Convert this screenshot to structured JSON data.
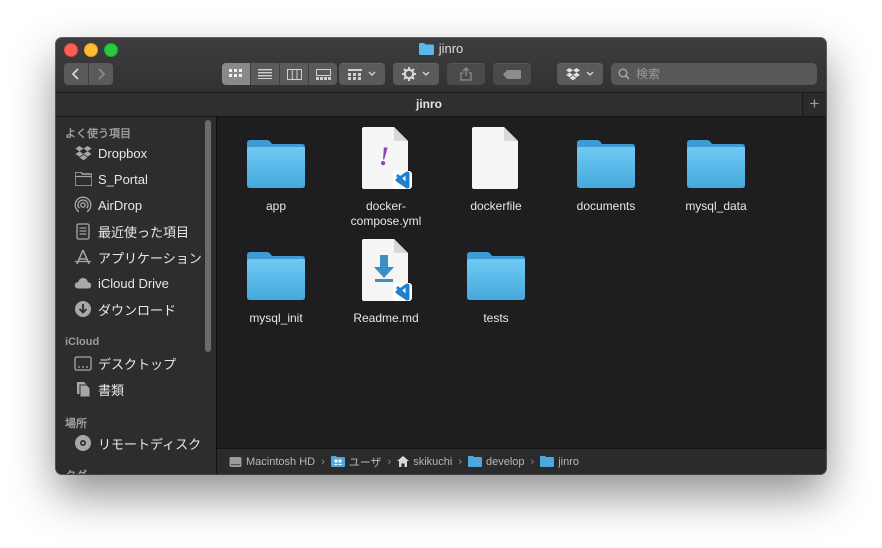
{
  "window": {
    "title": "jinro",
    "traffic_lights": [
      "close",
      "minimize",
      "zoom"
    ]
  },
  "toolbar": {
    "back_label": "‹",
    "forward_label": "›",
    "view_modes": [
      "icon-view",
      "list-view",
      "column-view",
      "gallery-view"
    ],
    "active_view": "icon-view",
    "search_placeholder": "検索"
  },
  "tabbar": {
    "tab_label": "jinro",
    "add_label": "+"
  },
  "sidebar": {
    "sections": [
      {
        "header": "よく使う項目",
        "items": [
          {
            "label": "Dropbox",
            "icon": "dropbox-icon"
          },
          {
            "label": "S_Portal",
            "icon": "folder-icon"
          },
          {
            "label": "AirDrop",
            "icon": "airdrop-icon"
          },
          {
            "label": "最近使った項目",
            "icon": "recents-icon"
          },
          {
            "label": "アプリケーション",
            "icon": "applications-icon"
          },
          {
            "label": "iCloud Drive",
            "icon": "cloud-icon"
          },
          {
            "label": "ダウンロード",
            "icon": "download-icon"
          }
        ]
      },
      {
        "header": "iCloud",
        "items": [
          {
            "label": "デスクトップ",
            "icon": "desktop-icon"
          },
          {
            "label": "書類",
            "icon": "documents-icon"
          }
        ]
      },
      {
        "header": "場所",
        "items": [
          {
            "label": "リモートディスク",
            "icon": "remote-disc-icon"
          }
        ]
      },
      {
        "header": "タグ",
        "items": []
      }
    ]
  },
  "files": [
    {
      "name": "app",
      "kind": "folder"
    },
    {
      "name": "docker-compose.yml",
      "display": [
        "docker-",
        "compose.yml"
      ],
      "kind": "yml"
    },
    {
      "name": "dockerfile",
      "kind": "blank"
    },
    {
      "name": "documents",
      "kind": "folder"
    },
    {
      "name": "mysql_data",
      "kind": "folder"
    },
    {
      "name": "mysql_init",
      "kind": "folder"
    },
    {
      "name": "Readme.md",
      "kind": "md"
    },
    {
      "name": "tests",
      "kind": "folder"
    }
  ],
  "pathbar": {
    "segments": [
      {
        "label": "Macintosh HD",
        "icon": "disk-icon"
      },
      {
        "label": "ユーザ",
        "icon": "users-folder-icon"
      },
      {
        "label": "skikuchi",
        "icon": "home-icon"
      },
      {
        "label": "develop",
        "icon": "folder-icon"
      },
      {
        "label": "jinro",
        "icon": "folder-icon"
      }
    ],
    "separator": "›"
  },
  "colors": {
    "folder_top": "#6bc8f2",
    "folder_bottom": "#3fa6dc",
    "vscode_blue": "#1f7fd0",
    "yml_purple": "#8e44ad",
    "md_arrow": "#3b8fc4"
  }
}
